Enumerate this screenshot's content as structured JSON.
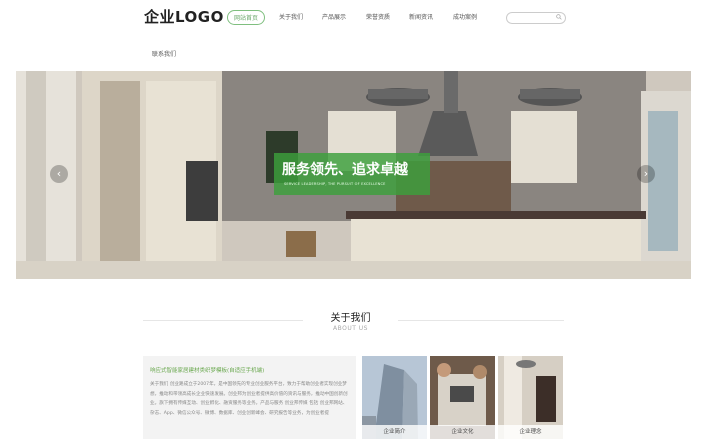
{
  "header": {
    "logo": "企业LOGO",
    "nav": [
      "网站首页",
      "关于我们",
      "产品展示",
      "荣誉资质",
      "新闻资讯",
      "成功案例",
      "联系我们"
    ]
  },
  "banner": {
    "slogan": "服务领先、追求卓越",
    "slogan_sub": "SERVICE LEADERSHIP, THE PURSUIT OF EXCELLENCE",
    "prev_glyph": "‹",
    "next_glyph": "›"
  },
  "about": {
    "title": "关于我们",
    "subtitle": "ABOUT US",
    "heading": "响应式智能家居建材类织梦模板(自适应手机端)",
    "body": "关于我们 创业路成立于2007年，是中国领先的专业创业服务平台，致力于帮助创业者实现创业梦想，推动和带领高成长企业快速发展。创业邦为创业者提供高价值的资讯与服务，推动中国创新创业。旗下拥有传媒互动、创业孵化、融资服务等业务。产品与服务 创业邦传媒 包括 创业邦网站、杂志、App、微信公众号、微博、数据库、创业创新峰会、研究报告等业务，为创业者提",
    "thumbs": [
      "企业简介",
      "企业文化",
      "企业理念"
    ]
  },
  "colors": {
    "accent": "#6aa84f",
    "banner_box": "#3ca03c"
  }
}
